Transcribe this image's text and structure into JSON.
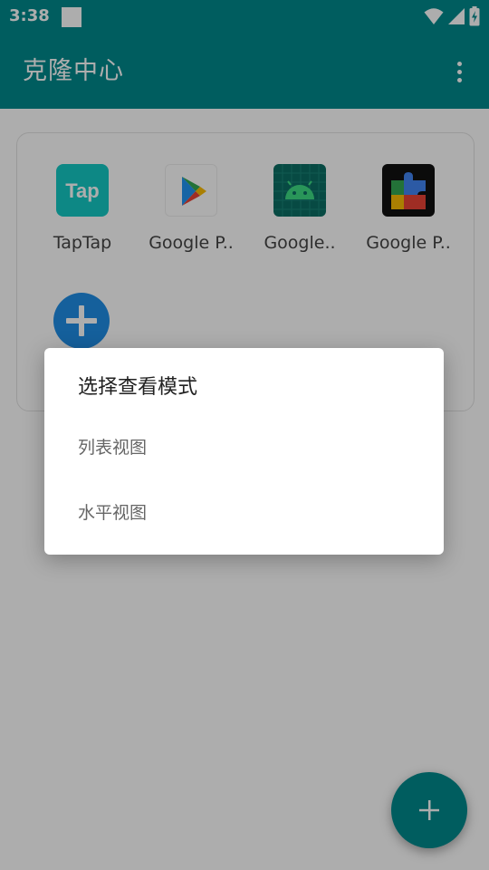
{
  "status_bar": {
    "time": "3:38",
    "icons": [
      "wifi-icon",
      "signal-icon",
      "battery-charging-icon"
    ]
  },
  "app_bar": {
    "title": "克隆中心",
    "menu_icon": "overflow-menu-icon"
  },
  "apps": [
    {
      "label": "TapTap",
      "icon": "taptap-icon"
    },
    {
      "label": "Google P..",
      "icon": "google-play-store-icon"
    },
    {
      "label": "Google..",
      "icon": "android-icon"
    },
    {
      "label": "Google P..",
      "icon": "google-play-services-icon"
    }
  ],
  "add_app": {
    "icon": "plus-icon"
  },
  "dialog": {
    "title": "选择查看模式",
    "options": [
      {
        "label": "列表视图"
      },
      {
        "label": "水平视图"
      }
    ]
  },
  "fab": {
    "icon": "plus-icon"
  },
  "colors": {
    "primary": "#00898d",
    "add_button": "#1f8ee6",
    "taptap": "#14c9c4",
    "android_tile": "#0b6e63",
    "android_green": "#3ddc84"
  }
}
